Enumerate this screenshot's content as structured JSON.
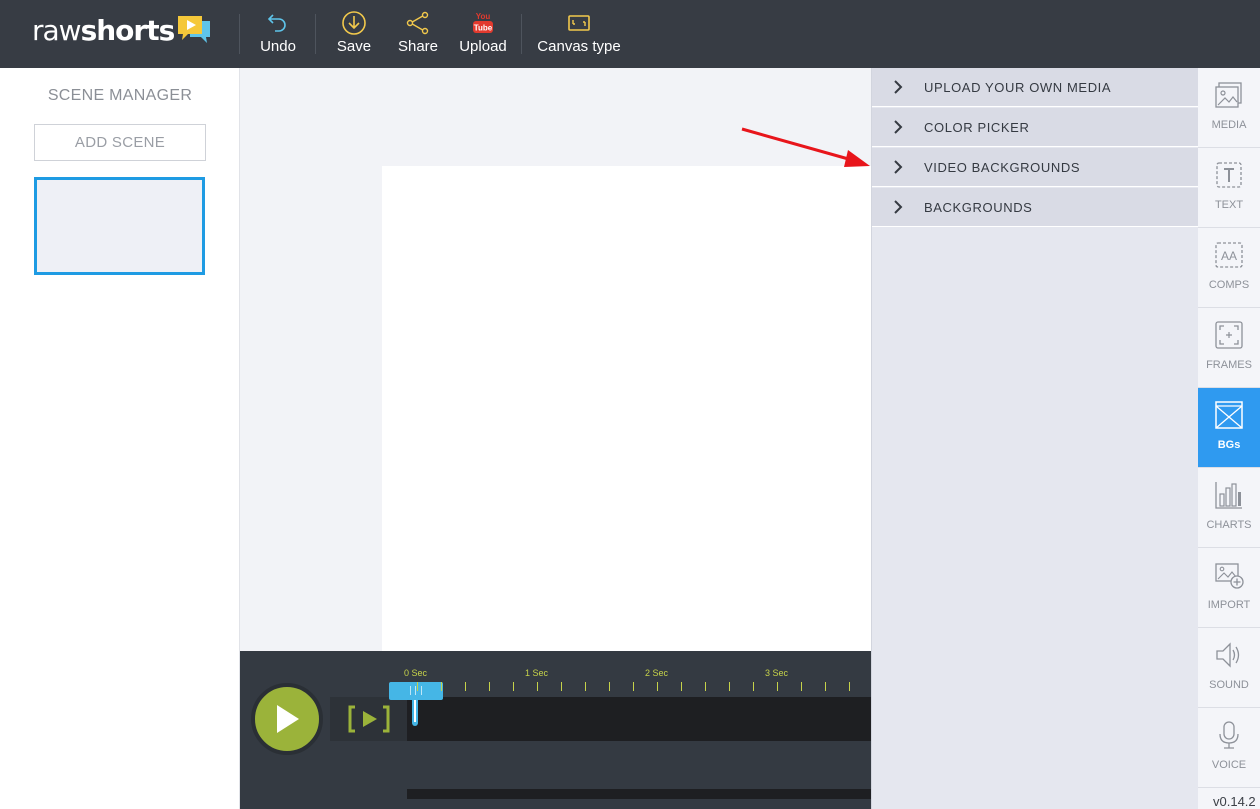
{
  "brand": {
    "part1": "raw",
    "part2": "shorts"
  },
  "toolbar": {
    "undo": "Undo",
    "save": "Save",
    "share": "Share",
    "upload": "Upload",
    "canvas_type": "Canvas type"
  },
  "scene_manager": {
    "title": "SCENE MANAGER",
    "add_scene": "ADD SCENE"
  },
  "timeline": {
    "labels": [
      "0 Sec",
      "1 Sec",
      "2 Sec",
      "3 Sec"
    ]
  },
  "bg_panel": {
    "items": [
      {
        "label": "UPLOAD YOUR OWN MEDIA"
      },
      {
        "label": "COLOR PICKER"
      },
      {
        "label": "VIDEO BACKGROUNDS"
      },
      {
        "label": "BACKGROUNDS"
      }
    ]
  },
  "side_tools": [
    {
      "label": "MEDIA"
    },
    {
      "label": "TEXT"
    },
    {
      "label": "COMPS"
    },
    {
      "label": "FRAMES"
    },
    {
      "label": "BGs",
      "active": true
    },
    {
      "label": "CHARTS"
    },
    {
      "label": "IMPORT"
    },
    {
      "label": "SOUND"
    },
    {
      "label": "VOICE"
    }
  ],
  "version": "v0.14.2",
  "colors": {
    "accent": "#f2c94c",
    "active_tab": "#2f9af0",
    "play": "#9bb33a",
    "ruler": "#c6d24a",
    "arrow": "#e8151b"
  }
}
